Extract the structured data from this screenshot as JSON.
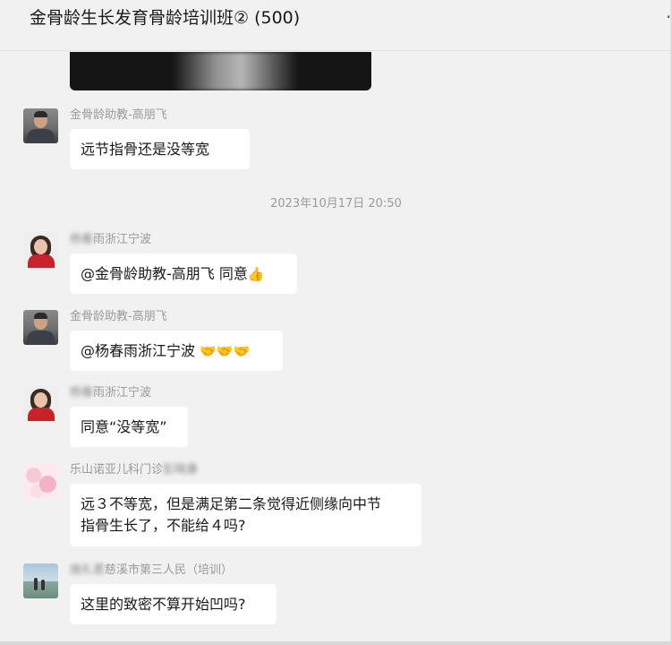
{
  "header": {
    "title": "金骨龄生长发育骨龄培训班② (500)"
  },
  "timestamp": "2023年10月17日 20:50",
  "messages": [
    {
      "sender": "金骨龄助教-高朋飞",
      "text": "远节指骨还是没等宽",
      "avatar": "man-avatar"
    },
    {
      "sender_blurred": "杨春",
      "sender": "雨浙江宁波",
      "text": "@金骨龄助教-高朋飞 同意",
      "emoji": "👍",
      "avatar": "woman-avatar"
    },
    {
      "sender": "金骨龄助教-高朋飞",
      "text": "@杨春雨浙江宁波 ",
      "emoji": "🤝🤝🤝",
      "avatar": "man-avatar"
    },
    {
      "sender_blurred": "杨春",
      "sender": "雨浙江宁波",
      "text": "同意“没等宽”",
      "avatar": "woman-avatar"
    },
    {
      "sender": "乐山诺亚儿科门诊",
      "sender_blurred": "彭晓康",
      "line1": "远３不等宽，但是满足第二条觉得近侧缘向中节",
      "line2": "指骨生长了，不能给４吗?",
      "avatar": "flower-avatar"
    },
    {
      "sender_blurred": "施礼君",
      "sender": "慈溪市第三人民（培训）",
      "text": "这里的致密不算开始凹吗?",
      "avatar": "beach-avatar"
    }
  ]
}
